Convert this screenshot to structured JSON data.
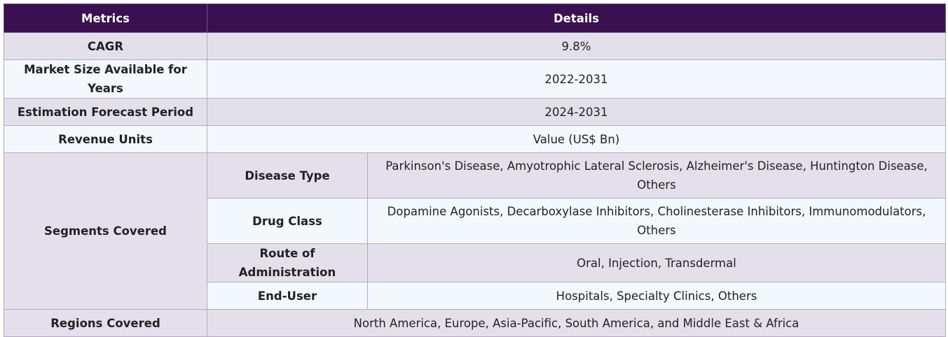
{
  "header": {
    "metrics": "Metrics",
    "details": "Details"
  },
  "rows": {
    "cagr": {
      "label": "CAGR",
      "value": "9.8%"
    },
    "market_size": {
      "label": "Market Size Available for Years",
      "value": "2022-2031"
    },
    "forecast": {
      "label": "Estimation Forecast Period",
      "value": "2024-2031"
    },
    "revenue": {
      "label": "Revenue Units",
      "value": "Value (US$ Bn)"
    },
    "segments": {
      "label": "Segments Covered",
      "disease_type": {
        "label": "Disease Type",
        "value": "Parkinson's Disease, Amyotrophic Lateral Sclerosis, Alzheimer's Disease, Huntington Disease, Others"
      },
      "drug_class": {
        "label": "Drug Class",
        "value": "Dopamine Agonists, Decarboxylase Inhibitors, Cholinesterase Inhibitors, Immunomodulators, Others"
      },
      "route": {
        "label": "Route of Administration",
        "value": "Oral, Injection, Transdermal"
      },
      "end_user": {
        "label": "End-User",
        "value": "Hospitals, Specialty Clinics, Others"
      }
    },
    "regions": {
      "label": "Regions Covered",
      "value": "North America, Europe, Asia-Pacific, South America, and Middle East & Africa"
    }
  }
}
